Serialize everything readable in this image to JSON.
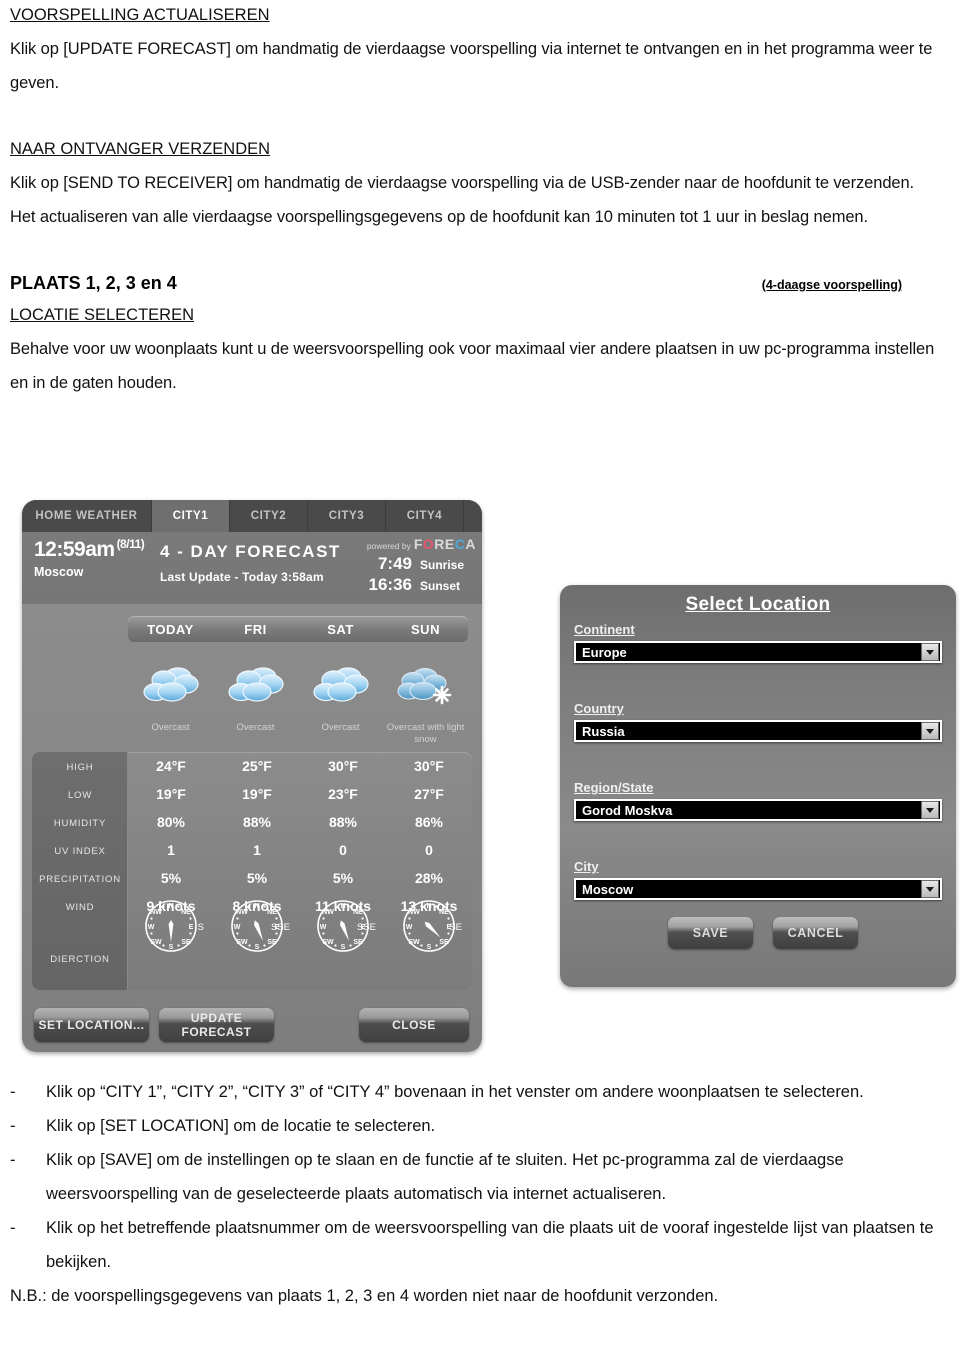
{
  "document": {
    "section1": {
      "heading": "VOORSPELLING ACTUALISEREN",
      "body": "Klik op [UPDATE FORECAST] om handmatig de vierdaagse voorspelling via internet te ontvangen en in het programma weer te geven."
    },
    "section2": {
      "heading": "NAAR ONTVANGER VERZENDEN",
      "body1": "Klik op [SEND TO RECEIVER] om handmatig de vierdaagse voorspelling via de USB-zender naar de hoofdunit te verzenden.",
      "body2": "Het actualiseren van alle vierdaagse voorspellingsgegevens op de hoofdunit kan 10 minuten tot 1 uur in beslag nemen."
    },
    "section3": {
      "title": "PLAATS 1, 2, 3 en 4",
      "title_note": "(4-daagse voorspelling)",
      "heading": "LOCATIE SELECTEREN",
      "body": "Behalve voor uw woonplaats kunt u de weersvoorspelling ook voor maximaal vier andere plaatsen in uw pc-programma instellen en in de gaten houden."
    },
    "bullets": [
      "Klik op “CITY 1”, “CITY 2”, “CITY 3” of “CITY 4” bovenaan in het venster om andere woonplaatsen te selecteren.",
      "Klik op [SET LOCATION] om de locatie te selecteren.",
      "Klik op [SAVE] om de instellingen op te slaan en de functie af te sluiten. Het pc-programma zal de vierdaagse weersvoorspelling van de geselecteerde plaats automatisch via internet actualiseren.",
      "Klik op het betreffende plaatsnummer om de weersvoorspelling van die plaats uit de vooraf ingestelde lijst van plaatsen te bekijken."
    ],
    "bullet_marker": "-",
    "note": "N.B.: de voorspellingsgegevens van plaats 1, 2, 3 en 4 worden niet naar de hoofdunit verzonden."
  },
  "weather_app": {
    "tabs": [
      {
        "label": "HOME WEATHER",
        "active": false
      },
      {
        "label": "CITY1",
        "active": true
      },
      {
        "label": "CITY2",
        "active": false
      },
      {
        "label": "CITY3",
        "active": false
      },
      {
        "label": "CITY4",
        "active": false
      }
    ],
    "header": {
      "time": "12:59am",
      "date": "(8/11)",
      "city": "Moscow",
      "forecast_title": "4 - DAY FORECAST",
      "last_update": "Last Update - Today 3:58am",
      "powered_by": "powered by",
      "brand": "FORECA",
      "sunrise_time": "7:49",
      "sunrise_label": "Sunrise",
      "sunset_time": "16:36",
      "sunset_label": "Sunset"
    },
    "days": [
      "TODAY",
      "FRI",
      "SAT",
      "SUN"
    ],
    "conditions": [
      "Overcast",
      "Overcast",
      "Overcast",
      "Overcast with light snow"
    ],
    "row_labels": [
      "HIGH",
      "LOW",
      "HUMIDITY",
      "UV INDEX",
      "PRECIPITATION",
      "WIND",
      "DIERCTION"
    ],
    "rows": {
      "high": [
        "24°F",
        "25°F",
        "30°F",
        "30°F"
      ],
      "low": [
        "19°F",
        "19°F",
        "23°F",
        "27°F"
      ],
      "humidity": [
        "80%",
        "88%",
        "88%",
        "86%"
      ],
      "uv_index": [
        "1",
        "1",
        "0",
        "0"
      ],
      "precipitation": [
        "5%",
        "5%",
        "5%",
        "28%"
      ],
      "wind": [
        "9 knots",
        "8 knots",
        "11 knots",
        "13 knots"
      ],
      "direction": [
        "S",
        "SSE",
        "SSE",
        "SE"
      ]
    },
    "compass_points": [
      "N",
      "NE",
      "E",
      "SE",
      "S",
      "SW",
      "W",
      "NW"
    ],
    "compass_angles": [
      180,
      158,
      158,
      135
    ],
    "buttons": {
      "set_location": "SET LOCATION...",
      "update_forecast": "UPDATE FORECAST",
      "close": "CLOSE"
    }
  },
  "select_location": {
    "title": "Select Location",
    "fields": [
      {
        "label": "Continent",
        "value": "Europe"
      },
      {
        "label": "Country",
        "value": "Russia"
      },
      {
        "label": "Region/State",
        "value": "Gorod Moskva"
      },
      {
        "label": "City",
        "value": "Moscow"
      }
    ],
    "save_label": "SAVE",
    "cancel_label": "CANCEL"
  },
  "colors": {
    "panel_bg": "#8a8a8a",
    "tab_bg": "#4a4a4a",
    "tab_active_bg": "#6f6f6f",
    "combo_bg": "#000000",
    "text_white": "#ffffff"
  }
}
